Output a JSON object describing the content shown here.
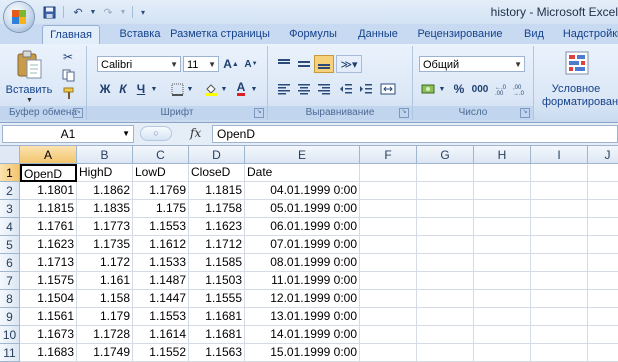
{
  "window": {
    "title": "history - Microsoft Excel"
  },
  "ribbon_tabs": [
    "Главная",
    "Вставка",
    "Разметка страницы",
    "Формулы",
    "Данные",
    "Рецензирование",
    "Вид",
    "Надстройки"
  ],
  "ribbon": {
    "clipboard": {
      "paste_label": "Вставить",
      "group_label": "Буфер обмена"
    },
    "font": {
      "font_name": "Calibri",
      "font_size": "11",
      "group_label": "Шрифт",
      "bold": "Ж",
      "italic": "К",
      "underline": "Ч"
    },
    "alignment": {
      "group_label": "Выравнивание"
    },
    "number": {
      "format": "Общий",
      "percent": "%",
      "thousands": "000",
      "group_label": "Число"
    },
    "styles": {
      "conditional_line1": "Условное",
      "conditional_line2": "форматирование"
    }
  },
  "formula_bar": {
    "name_box": "A1",
    "fx": "fx",
    "content": "OpenD"
  },
  "sheet": {
    "columns": [
      "A",
      "B",
      "C",
      "D",
      "E",
      "F",
      "G",
      "H",
      "I",
      "J"
    ],
    "rows": [
      {
        "num": "1",
        "cells": [
          "OpenD",
          "HighD",
          "LowD",
          "CloseD",
          "Date"
        ]
      },
      {
        "num": "2",
        "cells": [
          "1.1801",
          "1.1862",
          "1.1769",
          "1.1815",
          "04.01.1999 0:00"
        ]
      },
      {
        "num": "3",
        "cells": [
          "1.1815",
          "1.1835",
          "1.175",
          "1.1758",
          "05.01.1999 0:00"
        ]
      },
      {
        "num": "4",
        "cells": [
          "1.1761",
          "1.1773",
          "1.1553",
          "1.1623",
          "06.01.1999 0:00"
        ]
      },
      {
        "num": "5",
        "cells": [
          "1.1623",
          "1.1735",
          "1.1612",
          "1.1712",
          "07.01.1999 0:00"
        ]
      },
      {
        "num": "6",
        "cells": [
          "1.1713",
          "1.172",
          "1.1533",
          "1.1585",
          "08.01.1999 0:00"
        ]
      },
      {
        "num": "7",
        "cells": [
          "1.1575",
          "1.161",
          "1.1487",
          "1.1503",
          "11.01.1999 0:00"
        ]
      },
      {
        "num": "8",
        "cells": [
          "1.1504",
          "1.158",
          "1.1447",
          "1.1555",
          "12.01.1999 0:00"
        ]
      },
      {
        "num": "9",
        "cells": [
          "1.1561",
          "1.179",
          "1.1553",
          "1.1681",
          "13.01.1999 0:00"
        ]
      },
      {
        "num": "10",
        "cells": [
          "1.1673",
          "1.1728",
          "1.1614",
          "1.1681",
          "14.01.1999 0:00"
        ]
      },
      {
        "num": "11",
        "cells": [
          "1.1683",
          "1.1749",
          "1.1552",
          "1.1563",
          "15.01.1999 0:00"
        ]
      }
    ]
  },
  "colors": {
    "accent": "#15428b",
    "selected_header": "#f3c56e"
  }
}
